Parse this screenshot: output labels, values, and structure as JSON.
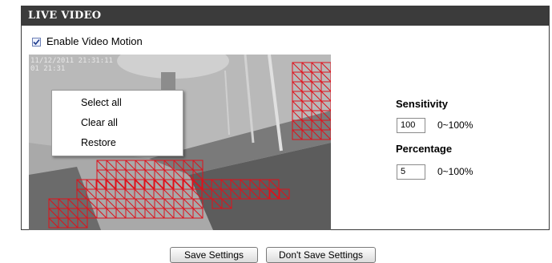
{
  "panel": {
    "title": "LIVE VIDEO"
  },
  "motion": {
    "enable_label": "Enable Video Motion",
    "enabled": true
  },
  "video": {
    "timestamp_line1": "11/12/2011 21:31:11",
    "timestamp_line2": "01 21:31"
  },
  "context_menu": {
    "items": [
      "Select all",
      "Clear all",
      "Restore"
    ]
  },
  "sensitivity": {
    "label": "Sensitivity",
    "value": "100",
    "range": "0~100%"
  },
  "percentage": {
    "label": "Percentage",
    "value": "5",
    "range": "0~100%"
  },
  "buttons": {
    "save": "Save Settings",
    "dont_save": "Don't Save Settings"
  },
  "colors": {
    "header_bg": "#3b3b3b",
    "grid_red": "#e0101a"
  }
}
